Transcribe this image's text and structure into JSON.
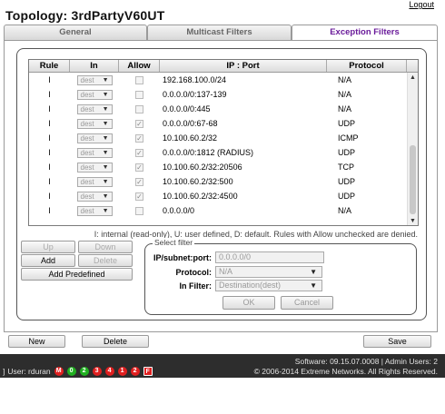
{
  "header": {
    "logout_label": "Logout",
    "title": "Topology: 3rdPartyV60UT"
  },
  "tabs": [
    {
      "label": "General"
    },
    {
      "label": "Multicast Filters"
    },
    {
      "label": "Exception Filters",
      "active": true
    }
  ],
  "table": {
    "columns": [
      "Rule",
      "In",
      "Allow",
      "IP : Port",
      "Protocol"
    ],
    "rows": [
      {
        "rule": "I",
        "in": "dest",
        "allow": false,
        "ip": "192.168.100.0/24",
        "protocol": "N/A"
      },
      {
        "rule": "I",
        "in": "dest",
        "allow": false,
        "ip": "0.0.0.0/0:137-139",
        "protocol": "N/A"
      },
      {
        "rule": "I",
        "in": "dest",
        "allow": false,
        "ip": "0.0.0.0/0:445",
        "protocol": "N/A"
      },
      {
        "rule": "I",
        "in": "dest",
        "allow": true,
        "ip": "0.0.0.0/0:67-68",
        "protocol": "UDP"
      },
      {
        "rule": "I",
        "in": "dest",
        "allow": true,
        "ip": "10.100.60.2/32",
        "protocol": "ICMP"
      },
      {
        "rule": "I",
        "in": "dest",
        "allow": true,
        "ip": "0.0.0.0/0:1812 (RADIUS)",
        "protocol": "UDP"
      },
      {
        "rule": "I",
        "in": "dest",
        "allow": true,
        "ip": "10.100.60.2/32:20506",
        "protocol": "TCP"
      },
      {
        "rule": "I",
        "in": "dest",
        "allow": true,
        "ip": "10.100.60.2/32:500",
        "protocol": "UDP"
      },
      {
        "rule": "I",
        "in": "dest",
        "allow": true,
        "ip": "10.100.60.2/32:4500",
        "protocol": "UDP"
      },
      {
        "rule": "I",
        "in": "dest",
        "allow": false,
        "ip": "0.0.0.0/0",
        "protocol": "N/A"
      }
    ]
  },
  "legend_note": "I: internal (read-only), U: user defined, D: default. Rules with Allow unchecked are denied.",
  "rule_buttons": {
    "up": "Up",
    "down": "Down",
    "add": "Add",
    "delete": "Delete",
    "add_predefined": "Add Predefined"
  },
  "select_filter": {
    "legend": "Select filter",
    "ip_label": "IP/subnet:port:",
    "ip_value": "0.0.0.0/0",
    "protocol_label": "Protocol:",
    "protocol_value": "N/A",
    "infilter_label": "In Filter:",
    "infilter_value": "Destination(dest)",
    "ok": "OK",
    "cancel": "Cancel"
  },
  "bottom_buttons": {
    "new": "New",
    "delete": "Delete",
    "save": "Save"
  },
  "statusbar": {
    "user_label": "User: rduran",
    "badges": [
      {
        "text": "M",
        "color": "#e02020"
      },
      {
        "text": "0",
        "color": "#20b020"
      },
      {
        "text": "2",
        "color": "#20b020"
      },
      {
        "text": "3",
        "color": "#e02020"
      },
      {
        "text": "4",
        "color": "#e02020"
      },
      {
        "text": "1",
        "color": "#e02020"
      },
      {
        "text": "2",
        "color": "#e02020"
      },
      {
        "text": "F",
        "color": "#e02020"
      }
    ],
    "software_line": "Software: 09.15.07.0008 | Admin Users: 2",
    "copyright_line": "© 2006-2014 Extreme Networks. All Rights Reserved."
  }
}
